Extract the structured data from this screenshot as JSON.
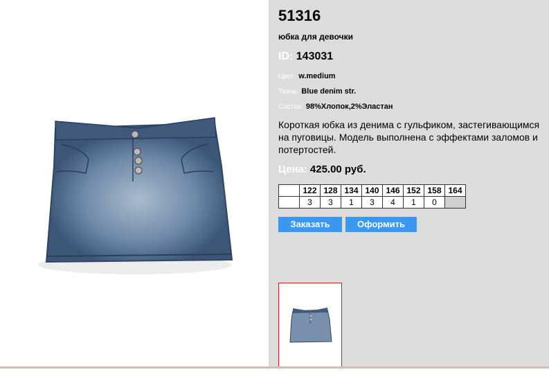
{
  "product": {
    "code": "51316",
    "name": "юбка для девочки",
    "id_label": "ID:",
    "id_value": "143031",
    "color_label": "Цвет:",
    "color_value": "w.medium",
    "fabric_label": "Ткань:",
    "fabric_value": "Blue denim str.",
    "composition_label": "Состав:",
    "composition_value": "98%Хлопок,2%Эластан",
    "description": "Короткая юбка из денима с гульфиком, застегивающимся на пуговицы. Модель выполнена с эффектами заломов и потертостей.",
    "price_label": "Цена:",
    "price_value": "425.00 руб."
  },
  "sizes": {
    "headers": [
      "122",
      "128",
      "134",
      "140",
      "146",
      "152",
      "158",
      "164"
    ],
    "stock": [
      "3",
      "3",
      "1",
      "3",
      "4",
      "1",
      "0",
      ""
    ]
  },
  "buttons": {
    "order": "Заказать",
    "checkout": "Оформить"
  },
  "colors": {
    "panel_bg": "#dcdcdc",
    "button_bg": "#3b98f0",
    "thumb_border": "#cc2222"
  }
}
